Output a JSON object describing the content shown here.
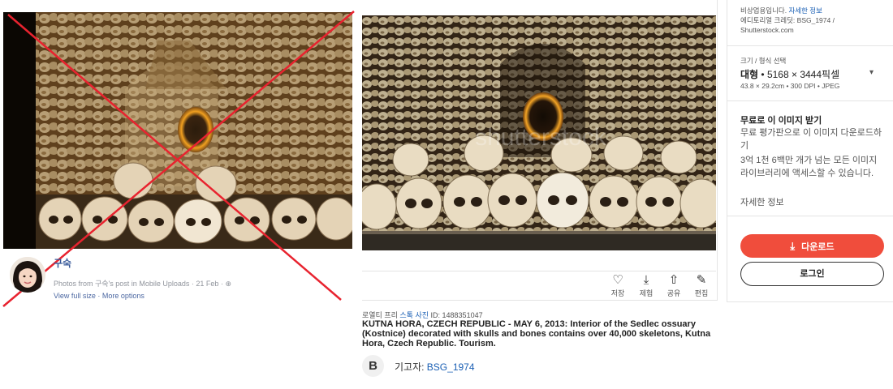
{
  "facebook_post": {
    "author_name": "구숙",
    "meta_text": "Photos from 구숙's post in Mobile Uploads",
    "date": "21 Feb",
    "separator": "·",
    "view_full_size": "View full size",
    "more_options": "More options"
  },
  "shutterstock": {
    "watermark": "shutterstock",
    "actions": [
      {
        "label": "저장",
        "icon": "heart-icon"
      },
      {
        "label": "제험",
        "icon": "download-icon"
      },
      {
        "label": "공유",
        "icon": "share-icon"
      },
      {
        "label": "편집",
        "icon": "edit-icon"
      }
    ],
    "license_text": "로열티 프리 ",
    "stock_photo_link": "스톡 사진",
    "id_text": " ID: 1488351047",
    "title": "KUTNA HORA, CZECH REPUBLIC - MAY 6, 2013: Interior of the Sedlec ossuary (Kostnice) decorated with skulls and bones contains over 40,000 skeletons, Kutna Hora, Czech Republic. Tourism.",
    "contributor_initial": "B",
    "contributor_label": "기고자: ",
    "contributor_name": "BSG_1974"
  },
  "sidebar": {
    "noncommercial_text": "비상업용입니다. ",
    "details_link": "자세한 정보",
    "credit_line": "에디토리얼 크레딧: BSG_1974 /",
    "credit_site": "Shutterstock.com",
    "size_format_label": "크기 / 형식 선택",
    "size_name": "대형",
    "size_pixels": " • 5168 × 3444픽셀",
    "size_detail": "43.8 × 29.2cm • 300 DPI • JPEG",
    "free_heading": "무료로 이 이미지 받기",
    "free_body": "무료 평가판으로 이 이미지 다운로드하기",
    "free_body2": "3억 1천 6백만 개가 넘는 모든 이미지 라이브러리에 액세스할 수 있습니다.",
    "more_info_link": "자세한 정보",
    "download_button": "다운로드",
    "login_button": "로그인"
  },
  "colors": {
    "accent_red": "#f04d3c",
    "link_blue": "#1a5fb4",
    "cross_red": "#e8232f"
  }
}
